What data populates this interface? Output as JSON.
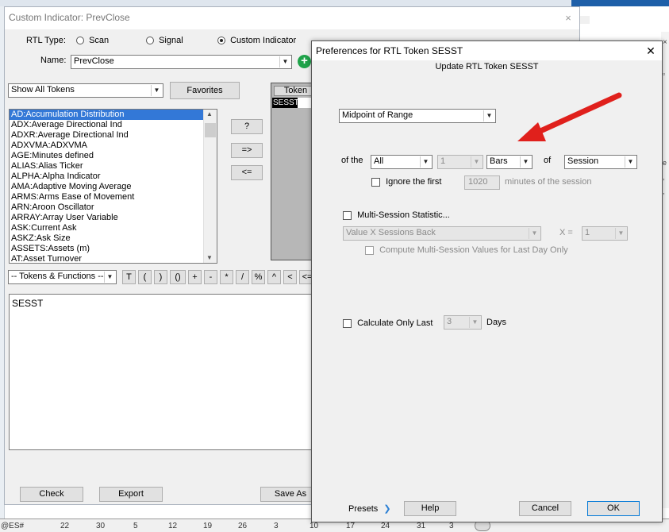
{
  "background": {
    "bottom_bar": {
      "symbol": "@ES#",
      "ticks": [
        "22",
        "30",
        "5",
        "12",
        "19",
        "26",
        "3",
        "10",
        "17",
        "24",
        "31",
        "3"
      ]
    }
  },
  "custom_indicator": {
    "title": "Custom Indicator: PrevClose",
    "close_glyph": "×",
    "rtl_type_label": "RTL Type:",
    "rtl_options": [
      {
        "label": "Scan",
        "selected": false
      },
      {
        "label": "Signal",
        "selected": false
      },
      {
        "label": "Custom Indicator",
        "selected": true
      }
    ],
    "name_label": "Name:",
    "name_value": "PrevClose",
    "token_filter": "Show All Tokens",
    "favorites_label": "Favorites",
    "tokens": [
      "AD:Accumulation Distribution",
      "ADX:Average Directional Ind",
      "ADXR:Average Directional Ind",
      "ADXVMA:ADXVMA",
      "AGE:Minutes defined",
      "ALIAS:Alias Ticker",
      "ALPHA:Alpha Indicator",
      "AMA:Adaptive Moving Average",
      "ARMS:Arms Ease of Movement",
      "ARN:Aroon Oscillator",
      "ARRAY:Array User Variable",
      "ASK:Current Ask",
      "ASKZ:Ask Size",
      "ASSETS:Assets (m)",
      "AT:Asset Turnover"
    ],
    "selected_token_index": 0,
    "help_button": "?",
    "add_button": "=>",
    "remove_button": "<=",
    "token_column_header": "Token",
    "token_column_value": "SESST",
    "functions_combo": "-- Tokens & Functions --",
    "operator_buttons": [
      "T",
      "(",
      ")",
      "()",
      "+",
      "-",
      "*",
      "/",
      "%",
      "^",
      "<",
      "<="
    ],
    "formula_text": "SESST",
    "check_button": "Check",
    "export_button": "Export",
    "save_as_button": "Save As"
  },
  "preferences": {
    "title": "Preferences for RTL Token SESST",
    "close_glyph": "✕",
    "subtitle": "Update RTL Token SESST",
    "statistic_value": "Midpoint of Range",
    "of_the_label": "of the",
    "range_value": "All",
    "count_value": "1",
    "unit_value": "Bars",
    "of_label": "of",
    "scope_value": "Session",
    "ignore_first_label": "Ignore the first",
    "ignore_first_checked": false,
    "ignore_minutes_value": "1020",
    "minutes_label": "minutes of the session",
    "multi_session_label": "Multi-Session Statistic...",
    "multi_session_checked": false,
    "multi_session_value": "Value X Sessions Back",
    "x_label": "X =",
    "x_value": "1",
    "compute_multi_label": "Compute Multi-Session Values for Last Day Only",
    "calc_last_label": "Calculate Only Last",
    "calc_last_checked": false,
    "calc_last_value": "3",
    "days_label": "Days",
    "presets_label": "Presets",
    "help_button": "Help",
    "cancel_button": "Cancel",
    "ok_button": "OK"
  },
  "colors": {
    "selection": "#3378d7",
    "annotation_arrow": "#e0201c",
    "plus_icon": "#1fa34a"
  }
}
